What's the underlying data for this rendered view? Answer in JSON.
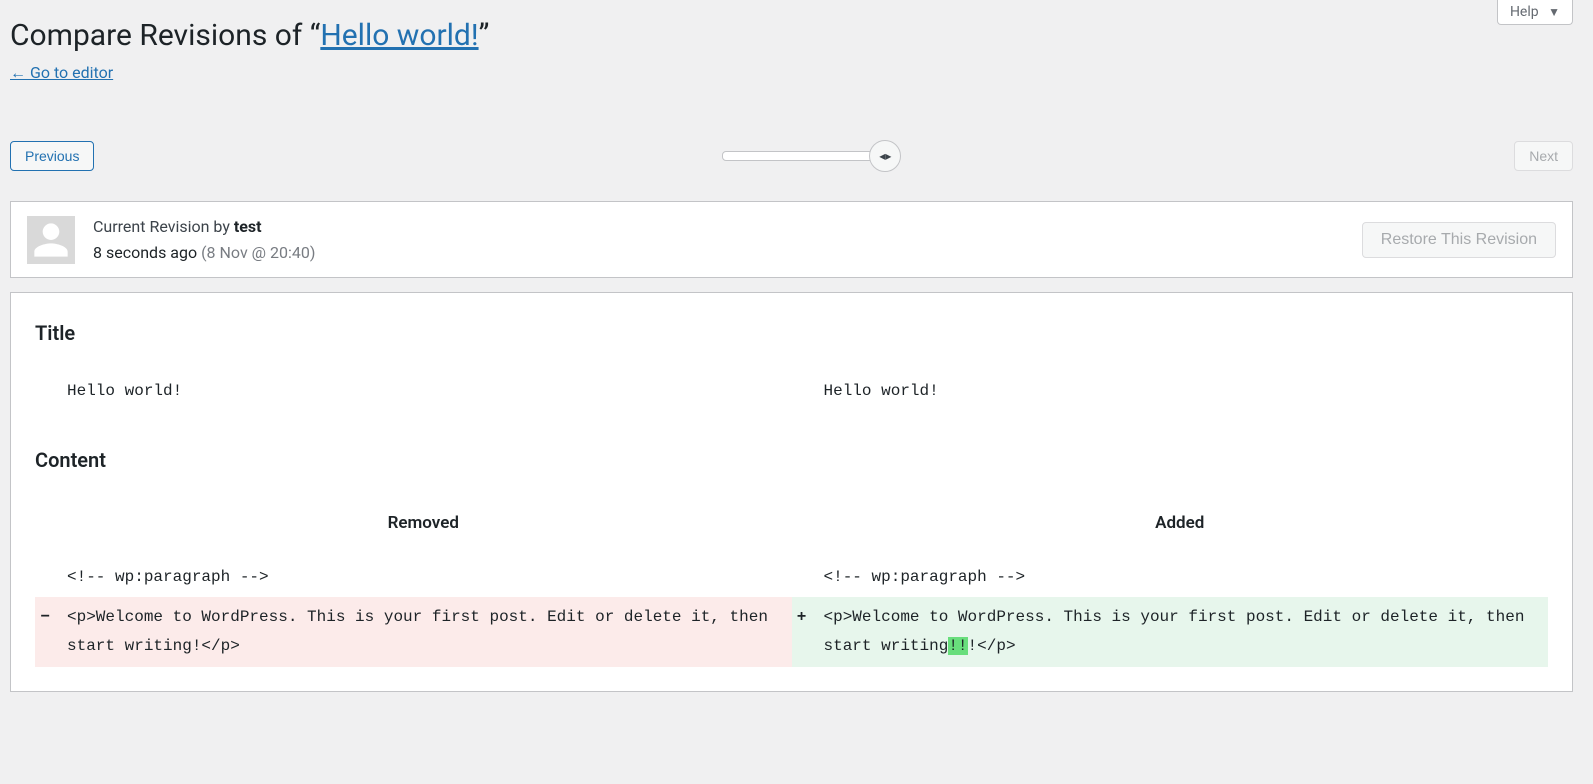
{
  "help": {
    "label": "Help"
  },
  "header": {
    "prefix": "Compare Revisions of “",
    "post_title": "Hello world!",
    "suffix": "”",
    "back_link": "← Go to editor"
  },
  "nav": {
    "previous": "Previous",
    "next": "Next"
  },
  "revision_meta": {
    "by_label": "Current Revision by ",
    "author": "test",
    "time_ago": "8 seconds ago",
    "time_abs": "(8 Nov @ 20:40)",
    "restore_label": "Restore This Revision"
  },
  "diff": {
    "title_heading": "Title",
    "title_left": "Hello world!",
    "title_right": "Hello world!",
    "content_heading": "Content",
    "col_removed": "Removed",
    "col_added": "Added",
    "ctx_left": "<!-- wp:paragraph -->",
    "ctx_right": "<!-- wp:paragraph -->",
    "minus": "−",
    "plus": "+",
    "removed_line": "<p>Welcome to WordPress. This is your first post. Edit or delete it, then start writing!</p>",
    "added_prefix": "<p>Welcome to WordPress. This is your first post. Edit or delete it, then start writing",
    "added_ins": "!!",
    "added_suffix": "!</p>"
  }
}
